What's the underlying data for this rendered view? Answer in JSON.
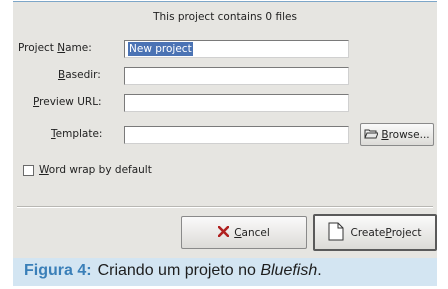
{
  "dialog": {
    "status_text": "This project contains 0 files",
    "fields": [
      {
        "label_pre": "Project ",
        "label_u": "N",
        "label_post": "ame:",
        "value": "New project"
      },
      {
        "label_pre": "",
        "label_u": "B",
        "label_post": "asedir:",
        "value": ""
      },
      {
        "label_pre": "",
        "label_u": "P",
        "label_post": "review URL:",
        "value": ""
      },
      {
        "label_pre": "",
        "label_u": "T",
        "label_post": "emplate:",
        "value": ""
      }
    ],
    "browse_button": {
      "label_pre": "B",
      "label_post": "rowse..."
    },
    "word_wrap": {
      "label_u": "W",
      "label_post": "ord wrap by default",
      "checked": false
    },
    "cancel_button": {
      "label_u": "C",
      "label_post": "ancel"
    },
    "create_button": {
      "label_pre": "Create ",
      "label_u": "P",
      "label_post": "roject"
    }
  },
  "caption": {
    "figure": "Figura 4:",
    "text": "Criando um projeto no ",
    "app": "Bluefish",
    "end": "."
  },
  "colors": {
    "dialog_bg": "#e6e5e1",
    "caption_bg": "#d3e5f2",
    "figure_label": "#3a7fb8",
    "selection": "#4b73b4"
  }
}
